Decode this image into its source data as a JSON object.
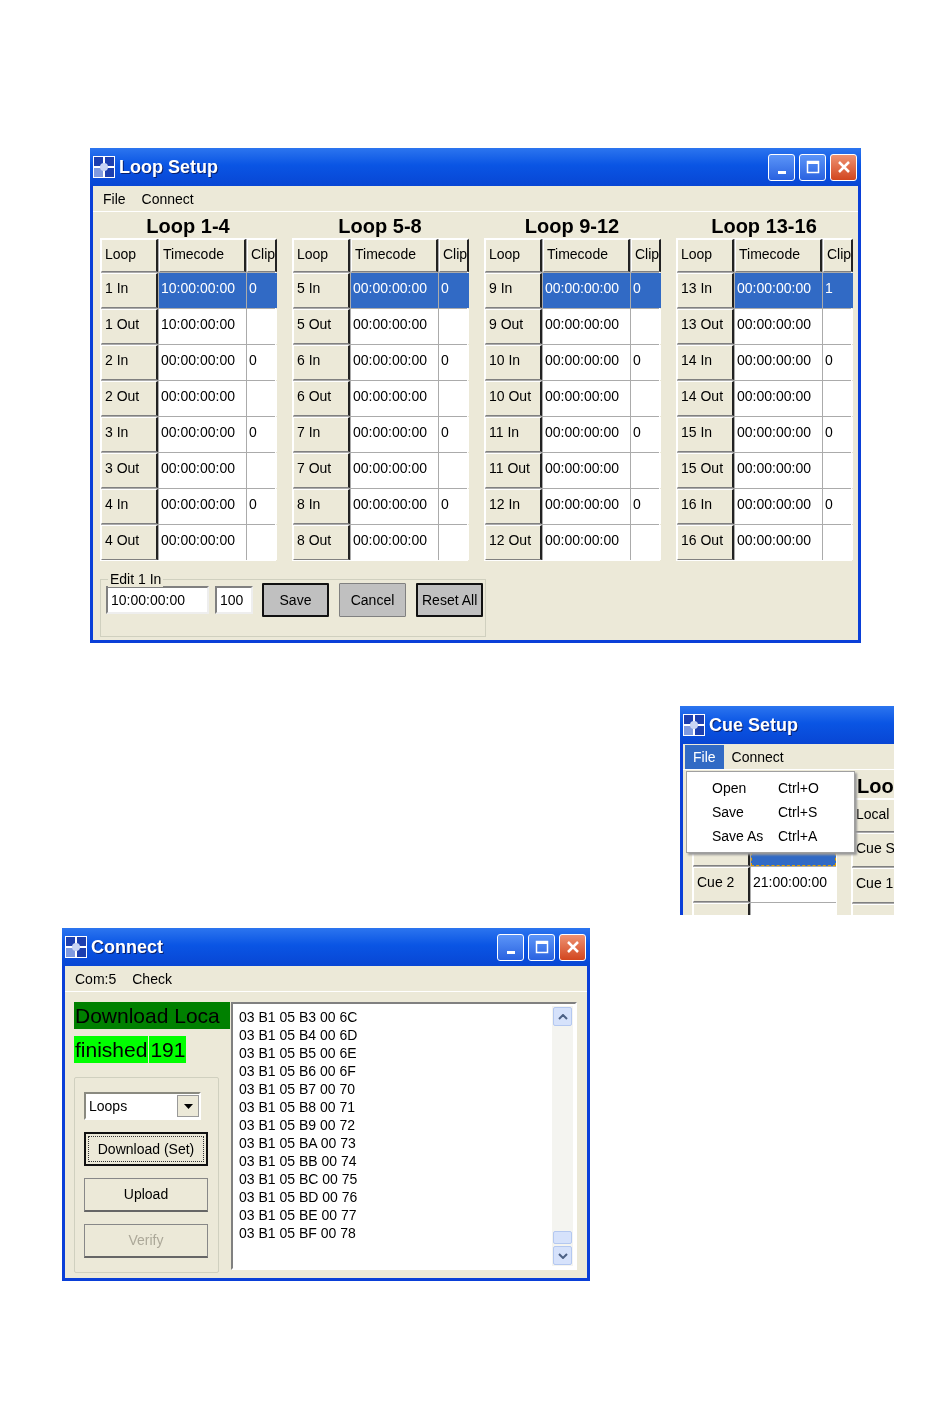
{
  "loop_setup": {
    "title": "Loop Setup",
    "menu": [
      "File",
      "Connect"
    ],
    "groups": [
      {
        "title": "Loop 1-4",
        "columns": [
          "Loop",
          "Timecode",
          "Clip"
        ],
        "rows": [
          {
            "loop": "1 In",
            "timecode": "10:00:00:00",
            "clip": "0",
            "selected": true
          },
          {
            "loop": "1 Out",
            "timecode": "10:00:00:00",
            "selected": false
          },
          {
            "loop": "2 In",
            "timecode": "00:00:00:00",
            "clip": "0",
            "selected": false
          },
          {
            "loop": "2 Out",
            "timecode": "00:00:00:00",
            "selected": false
          },
          {
            "loop": "3 In",
            "timecode": "00:00:00:00",
            "clip": "0",
            "selected": false
          },
          {
            "loop": "3 Out",
            "timecode": "00:00:00:00",
            "selected": false
          },
          {
            "loop": "4 In",
            "timecode": "00:00:00:00",
            "clip": "0",
            "selected": false
          },
          {
            "loop": "4 Out",
            "timecode": "00:00:00:00",
            "selected": false
          }
        ]
      },
      {
        "title": "Loop 5-8",
        "columns": [
          "Loop",
          "Timecode",
          "Clip"
        ],
        "rows": [
          {
            "loop": "5 In",
            "timecode": "00:00:00:00",
            "clip": "0",
            "selected": true
          },
          {
            "loop": "5 Out",
            "timecode": "00:00:00:00",
            "selected": false
          },
          {
            "loop": "6 In",
            "timecode": "00:00:00:00",
            "clip": "0",
            "selected": false
          },
          {
            "loop": "6 Out",
            "timecode": "00:00:00:00",
            "selected": false
          },
          {
            "loop": "7 In",
            "timecode": "00:00:00:00",
            "clip": "0",
            "selected": false
          },
          {
            "loop": "7 Out",
            "timecode": "00:00:00:00",
            "selected": false
          },
          {
            "loop": "8 In",
            "timecode": "00:00:00:00",
            "clip": "0",
            "selected": false
          },
          {
            "loop": "8 Out",
            "timecode": "00:00:00:00",
            "selected": false
          }
        ]
      },
      {
        "title": "Loop 9-12",
        "columns": [
          "Loop",
          "Timecode",
          "Clip"
        ],
        "rows": [
          {
            "loop": "9 In",
            "timecode": "00:00:00:00",
            "clip": "0",
            "selected": true
          },
          {
            "loop": "9 Out",
            "timecode": "00:00:00:00",
            "selected": false
          },
          {
            "loop": "10 In",
            "timecode": "00:00:00:00",
            "clip": "0",
            "selected": false
          },
          {
            "loop": "10 Out",
            "timecode": "00:00:00:00",
            "selected": false
          },
          {
            "loop": "11 In",
            "timecode": "00:00:00:00",
            "clip": "0",
            "selected": false
          },
          {
            "loop": "11 Out",
            "timecode": "00:00:00:00",
            "selected": false
          },
          {
            "loop": "12 In",
            "timecode": "00:00:00:00",
            "clip": "0",
            "selected": false
          },
          {
            "loop": "12 Out",
            "timecode": "00:00:00:00",
            "selected": false
          }
        ]
      },
      {
        "title": "Loop 13-16",
        "columns": [
          "Loop",
          "Timecode",
          "Clip"
        ],
        "rows": [
          {
            "loop": "13 In",
            "timecode": "00:00:00:00",
            "clip": "1",
            "selected": true
          },
          {
            "loop": "13 Out",
            "timecode": "00:00:00:00",
            "selected": false
          },
          {
            "loop": "14 In",
            "timecode": "00:00:00:00",
            "clip": "0",
            "selected": false
          },
          {
            "loop": "14 Out",
            "timecode": "00:00:00:00",
            "selected": false
          },
          {
            "loop": "15 In",
            "timecode": "00:00:00:00",
            "clip": "0",
            "selected": false
          },
          {
            "loop": "15 Out",
            "timecode": "00:00:00:00",
            "selected": false
          },
          {
            "loop": "16 In",
            "timecode": "00:00:00:00",
            "clip": "0",
            "selected": false
          },
          {
            "loop": "16 Out",
            "timecode": "00:00:00:00",
            "selected": false
          }
        ]
      }
    ],
    "edit": {
      "legend": "Edit 1 In",
      "timecode": "10:00:00:00",
      "clip": "100",
      "buttons": [
        {
          "label": "Save",
          "default": true
        },
        {
          "label": "Cancel",
          "default": false
        },
        {
          "label": "Reset All",
          "default": true
        }
      ]
    }
  },
  "cue_setup": {
    "title": "Cue Setup",
    "menu": [
      {
        "label": "File",
        "selected": true
      },
      {
        "label": "Connect",
        "selected": false
      }
    ],
    "file_menu": [
      {
        "label": "Open",
        "shortcut": "Ctrl+O"
      },
      {
        "label": "Save",
        "shortcut": "Ctrl+S"
      },
      {
        "label": "Save As",
        "shortcut": "Ctrl+A"
      }
    ],
    "cue_rows": [
      {
        "selected": true
      },
      {
        "cue": "Cue 2",
        "timecode": "21:00:00:00",
        "selected": false
      }
    ],
    "side_title": "Loo",
    "side_cells": [
      "Local",
      "Cue S",
      "Cue 1"
    ]
  },
  "connect": {
    "title": "Connect",
    "menu": [
      "Com:5",
      "Check"
    ],
    "status": [
      {
        "parts": [
          "Download Loca"
        ],
        "color": "#008000"
      },
      {
        "parts": [
          "finished",
          "191"
        ],
        "color": "#00ff00"
      }
    ],
    "mode": "Loops",
    "buttons": [
      {
        "label": "Download (Set)",
        "focused": true,
        "disabled": false
      },
      {
        "label": "Upload",
        "focused": false,
        "disabled": false
      },
      {
        "label": "Verify",
        "focused": false,
        "disabled": true
      }
    ],
    "log": [
      "03 B1 05 B3 00 6C",
      "03 B1 05 B4 00 6D",
      "03 B1 05 B5 00 6E",
      "03 B1 05 B6 00 6F",
      "03 B1 05 B7 00 70",
      "03 B1 05 B8 00 71",
      "03 B1 05 B9 00 72",
      "03 B1 05 BA 00 73",
      "03 B1 05 BB 00 74",
      "03 B1 05 BC 00 75",
      "03 B1 05 BD 00 76",
      "03 B1 05 BE 00 77",
      "03 B1 05 BF 00 78"
    ]
  }
}
